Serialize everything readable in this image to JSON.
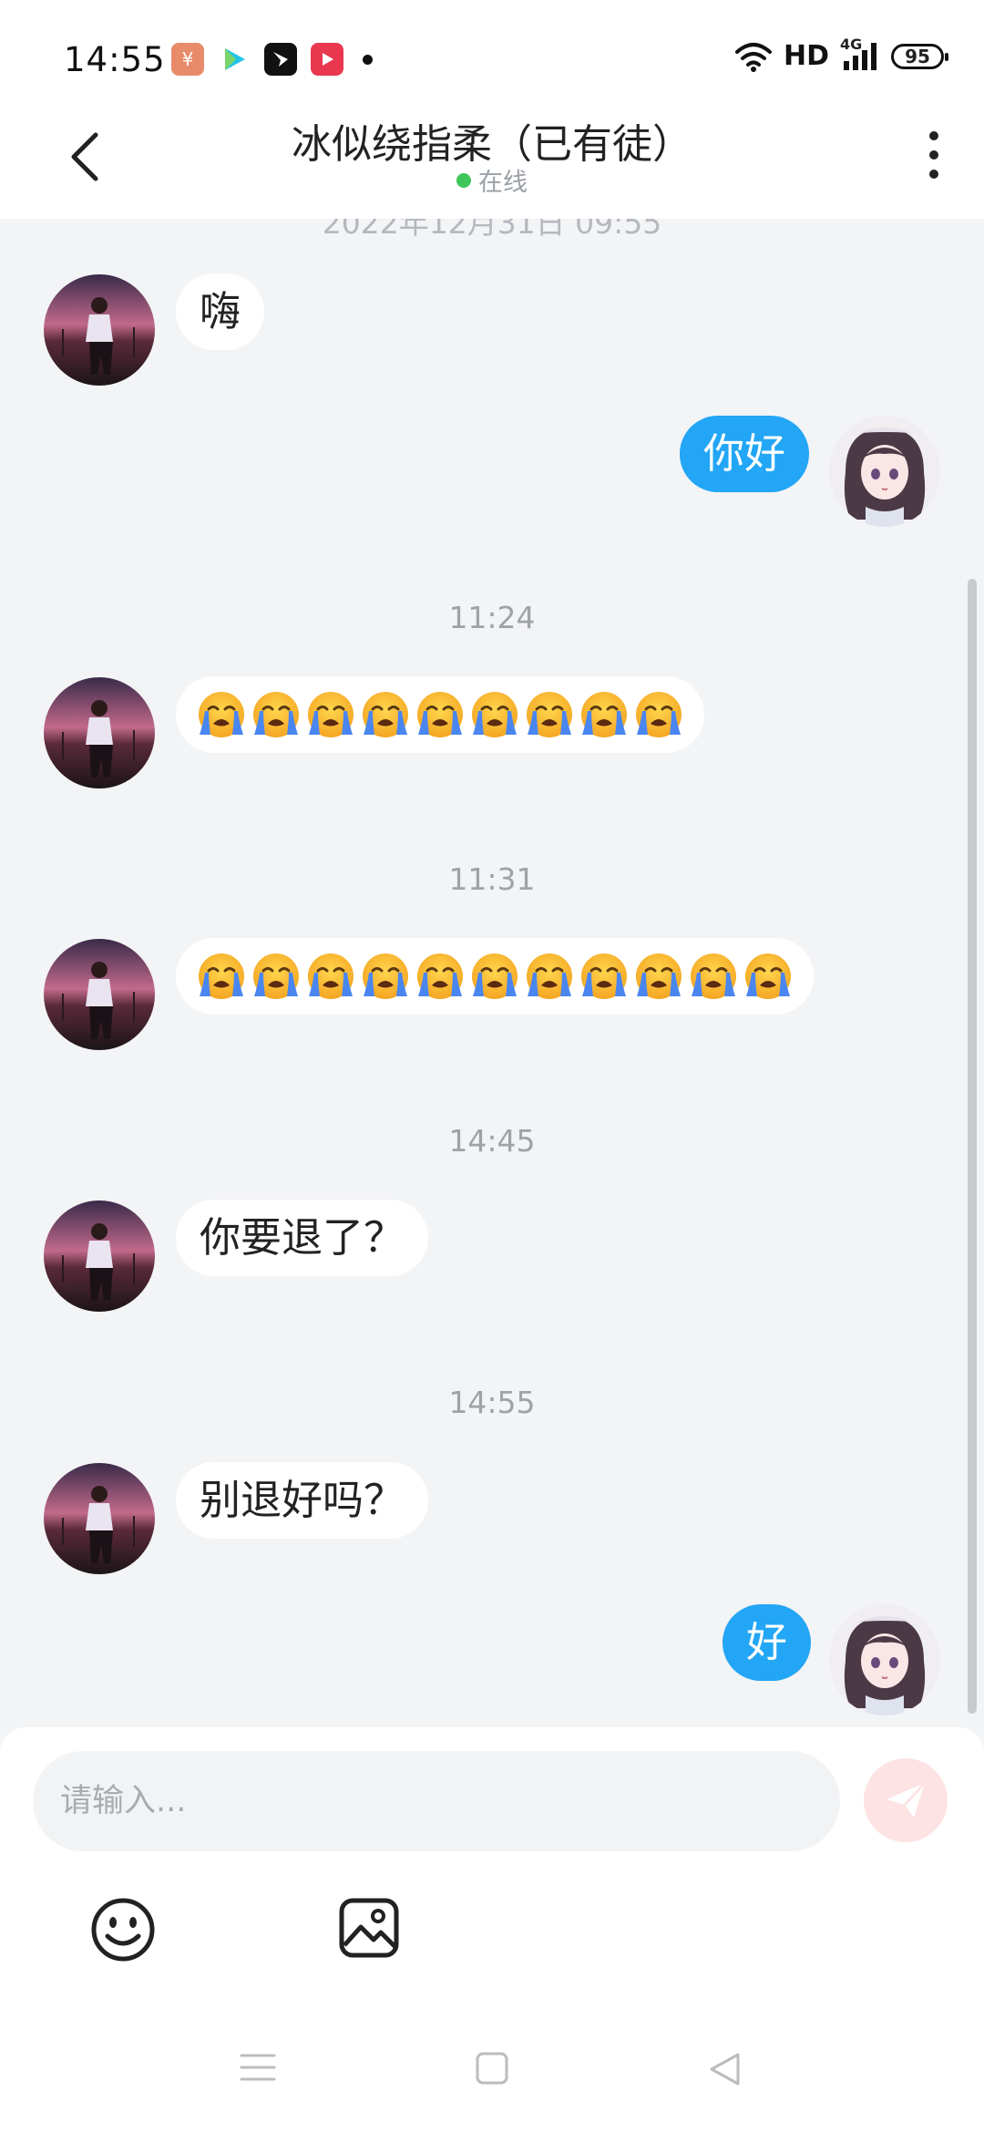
{
  "status_bar": {
    "time": "14:55",
    "network_label": "HD",
    "signal_label": "4G",
    "battery": "95",
    "app_icons": [
      "yen-app-icon",
      "video-play-app-icon",
      "messenger-app-icon",
      "video-app-icon"
    ]
  },
  "header": {
    "title": "冰似绕指柔（已有徒）",
    "status": "在线",
    "status_color": "#3fc65a"
  },
  "messages": {
    "partial_timestamp": "2022年12月31日 09:55",
    "m1_text": "嗨",
    "m2_text": "你好",
    "ts1": "11:24",
    "m3_emoji": "loudly-crying-face",
    "m3_count": 9,
    "ts2": "11:31",
    "m4_emoji": "loudly-crying-face",
    "m4_count": 11,
    "ts3": "14:45",
    "m5_text": "你要退了？",
    "ts4": "14:55",
    "m6_text": "别退好吗？",
    "m7_text": "好"
  },
  "input": {
    "placeholder": "请输入..."
  },
  "toolbar": {
    "emoji_icon": "smiley-icon",
    "image_icon": "image-icon",
    "send_icon": "paper-plane-icon"
  },
  "colors": {
    "accent_blue": "#22a6f5",
    "background": "#f3f4f6",
    "send_disabled": "#fde3e3"
  }
}
